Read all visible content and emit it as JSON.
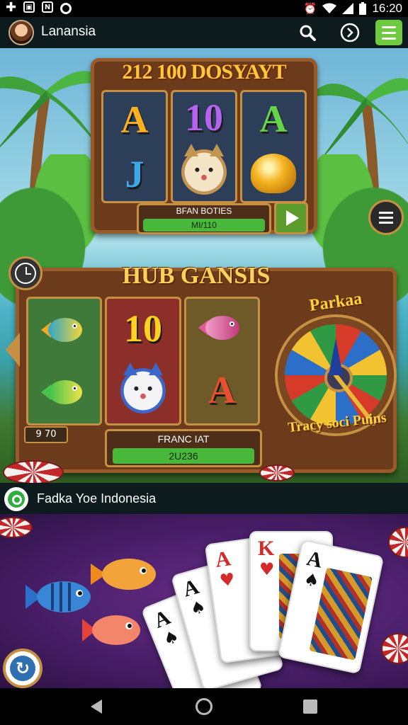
{
  "status_bar": {
    "time": "16:20",
    "icons": [
      "plus-icon",
      "photo-icon",
      "n-icon",
      "circle-icon",
      "alarm-icon",
      "wifi-icon",
      "signal-icon",
      "battery-icon"
    ]
  },
  "app_bar": {
    "title": "Lanansia",
    "icons": [
      "avatar",
      "search-icon",
      "forward-icon",
      "menu-icon"
    ]
  },
  "slot_top": {
    "title": "212 100 DOSYAYT",
    "reels": [
      [
        "A",
        "J"
      ],
      [
        "10",
        "cat"
      ],
      [
        "A",
        "gold-bird"
      ]
    ],
    "panel_label": "BFAN BOTIES",
    "panel_value": "MI/110"
  },
  "slot_main": {
    "title": "HUB GANSIS",
    "reels": [
      [
        "fish",
        "fish"
      ],
      [
        "10",
        "cat"
      ],
      [
        "fish",
        "A"
      ]
    ],
    "wheel_top": "Parkaa",
    "wheel_bottom": "Tracy soci Puins",
    "small_badge": "9 70",
    "panel_label": "FRANC IAT",
    "panel_value": "2U236"
  },
  "banner": {
    "text": "Fadka Yoe Indonesia"
  },
  "cards": {
    "cards": [
      {
        "rank": "A",
        "suit": "♠",
        "color": "#111111"
      },
      {
        "rank": "A",
        "suit": "♠",
        "color": "#111111"
      },
      {
        "rank": "A",
        "suit": "♥",
        "color": "#d42a2a"
      },
      {
        "rank": "K",
        "suit": "♥",
        "color": "#d42a2a"
      },
      {
        "rank": "A",
        "suit": "♠",
        "color": "#111111"
      }
    ]
  },
  "nav_bar": {
    "icons": [
      "back-icon",
      "home-icon",
      "recent-apps-icon"
    ]
  },
  "colors": {
    "app_bar_bg": "#0d1b1e",
    "menu_button": "#6ecb3f",
    "wood": "#6b3b1c",
    "gold": "#c69042",
    "progress_green": "#48b83a",
    "cards_bg": "#4a1f6a"
  }
}
